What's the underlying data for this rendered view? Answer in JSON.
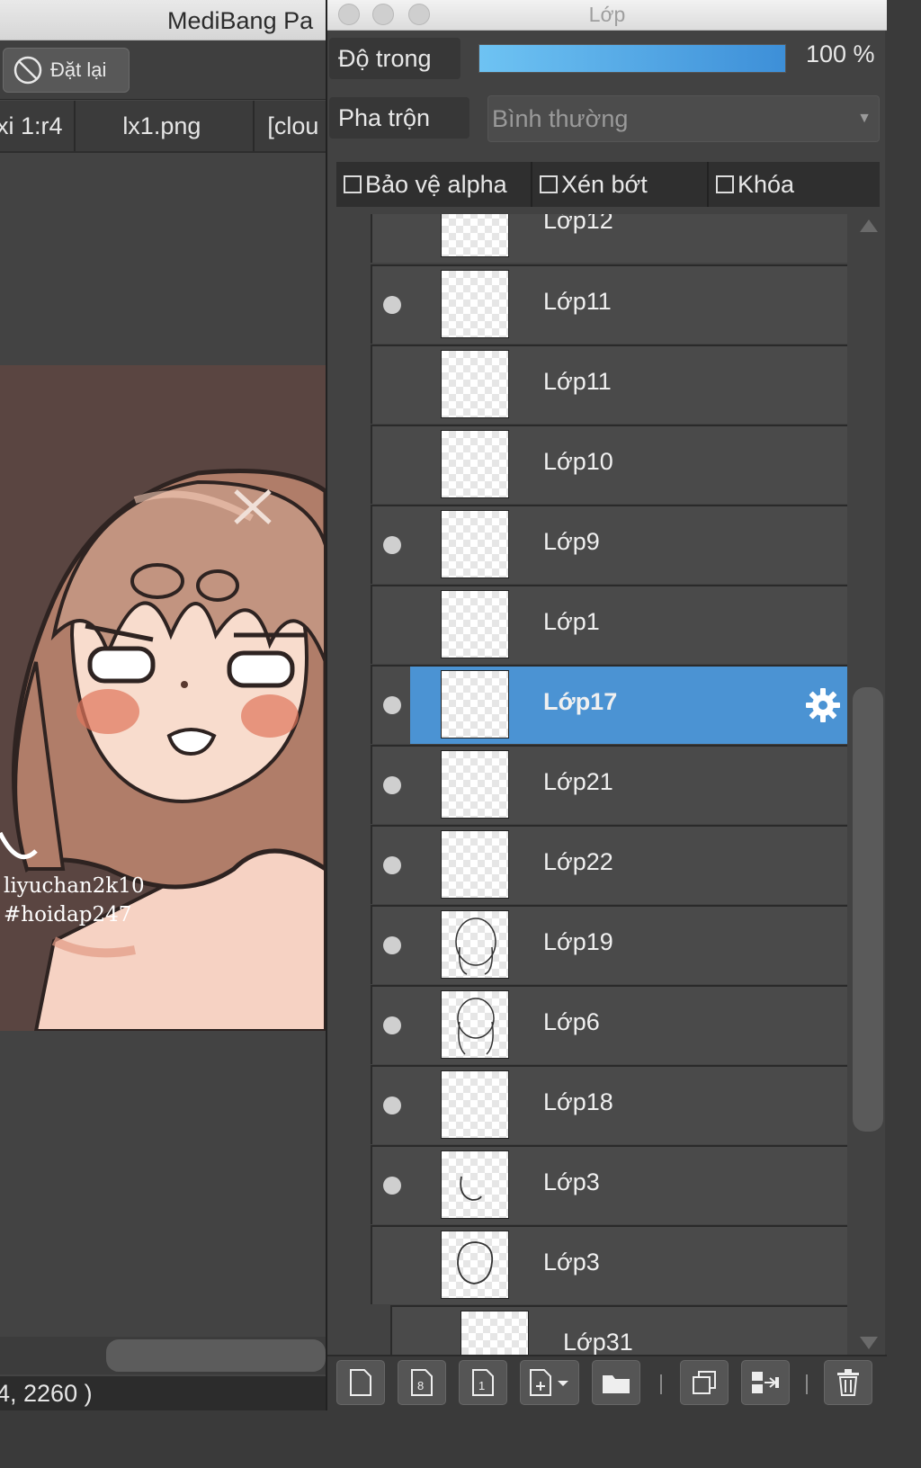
{
  "main_window": {
    "title": "MediBang Pa",
    "toolbar": {
      "reset_label": "Đặt lại"
    },
    "tabs": [
      "xi 1:r4",
      "lx1.png",
      "[clou"
    ],
    "canvas": {
      "watermark": [
        "liyuchan2k10",
        "#hoidap247"
      ]
    },
    "status": {
      "coordinates": "4, 2260 )"
    }
  },
  "layer_panel": {
    "title": "Lớp",
    "opacity": {
      "label": "Độ trong",
      "value": 100,
      "value_text": "100 %"
    },
    "blend": {
      "label": "Pha trộn",
      "value": "Bình thường"
    },
    "checkboxes": [
      {
        "label": "Bảo vệ alpha",
        "checked": false
      },
      {
        "label": "Xén bớt",
        "checked": false
      },
      {
        "label": "Khóa",
        "checked": false
      }
    ],
    "layers": [
      {
        "name": "Lớp12",
        "visible": false,
        "selected": false
      },
      {
        "name": "Lớp11",
        "visible": true,
        "selected": false
      },
      {
        "name": "Lớp11",
        "visible": false,
        "selected": false
      },
      {
        "name": "Lớp10",
        "visible": false,
        "selected": false
      },
      {
        "name": "Lớp9",
        "visible": true,
        "selected": false
      },
      {
        "name": "Lớp1",
        "visible": false,
        "selected": false
      },
      {
        "name": "Lớp17",
        "visible": true,
        "selected": true
      },
      {
        "name": "Lớp21",
        "visible": true,
        "selected": false
      },
      {
        "name": "Lớp22",
        "visible": true,
        "selected": false
      },
      {
        "name": "Lớp19",
        "visible": true,
        "selected": false
      },
      {
        "name": "Lớp6",
        "visible": true,
        "selected": false
      },
      {
        "name": "Lớp18",
        "visible": true,
        "selected": false
      },
      {
        "name": "Lớp3",
        "visible": true,
        "selected": false
      },
      {
        "name": "Lớp3",
        "visible": false,
        "selected": false
      },
      {
        "name": "Lớp31",
        "visible": false,
        "selected": false
      }
    ],
    "toolbar_icons": [
      "new-layer-icon",
      "new-8bit-layer-icon",
      "new-1bit-layer-icon",
      "add-special-layer-icon",
      "new-folder-icon",
      "duplicate-layer-icon",
      "merge-down-icon",
      "delete-layer-icon"
    ],
    "accent_color": "#4b93d3"
  }
}
